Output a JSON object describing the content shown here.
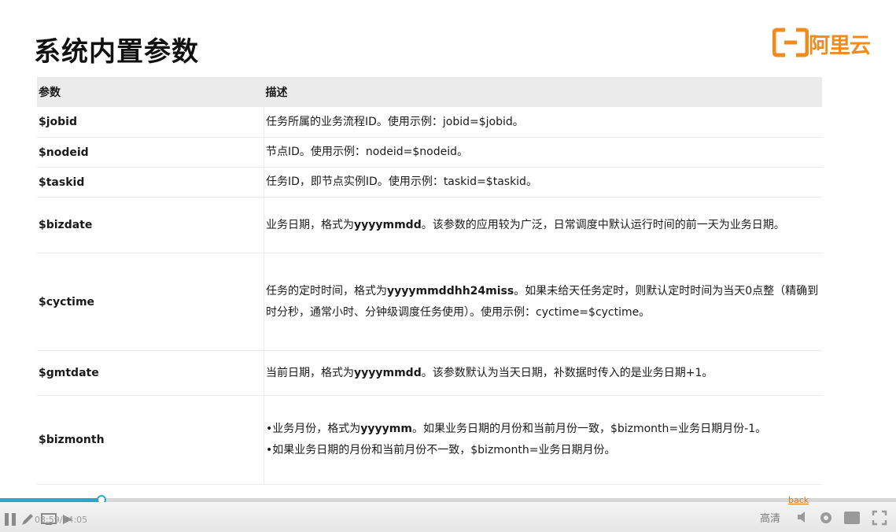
{
  "slide": {
    "title": "系统内置参数",
    "logo_text": "阿里云"
  },
  "table": {
    "headers": [
      "参数",
      "描述"
    ],
    "rows": [
      {
        "param": "$jobid",
        "desc_html": "任务所属的业务流程ID。使用示例：jobid=$jobid。"
      },
      {
        "param": "$nodeid",
        "desc_html": "节点ID。使用示例：nodeid=$nodeid。"
      },
      {
        "param": "$taskid",
        "desc_html": "任务ID，即节点实例ID。使用示例：taskid=$taskid。"
      },
      {
        "param": "$bizdate",
        "desc_html": "业务日期，格式为<b>yyyymmdd</b>。该参数的应用较为广泛，日常调度中默认运行时间的前一天为业务日期。"
      },
      {
        "param": "$cyctime",
        "desc_html": "任务的定时时间，格式为<b>yyyymmddhh24miss</b>。如果未给天任务定时，则默认定时时间为当天0点整（精确到<br>时分秒，通常小时、分钟级调度任务使用）。使用示例：cyctime=$cyctime。"
      },
      {
        "param": "$gmtdate",
        "desc_html": "当前日期，格式为<b>yyyymmdd</b>。该参数默认为当天日期，补数据时传入的是业务日期+1。"
      },
      {
        "param": "$bizmonth",
        "desc_html": "•业务月份，格式为<b>yyyymm</b>。如果业务日期的月份和当前月份一致，$bizmonth=业务日期月份-1。<br>•如果业务日期的月份和当前月份不一致，$bizmonth=业务日期月份。"
      }
    ]
  },
  "player": {
    "time_display": "03:59/14:05",
    "progress": 0.113,
    "quality_label": "高清",
    "back_label": "back",
    "icons": [
      "pause-icon",
      "pen-icon",
      "screen-icon",
      "next-icon",
      "volume-icon",
      "settings-icon",
      "subtitles-icon",
      "fullscreen-icon"
    ]
  },
  "colors": {
    "accent": "#2aa5d8",
    "logo": "#f08c1e",
    "header_bg": "#ebebeb"
  }
}
